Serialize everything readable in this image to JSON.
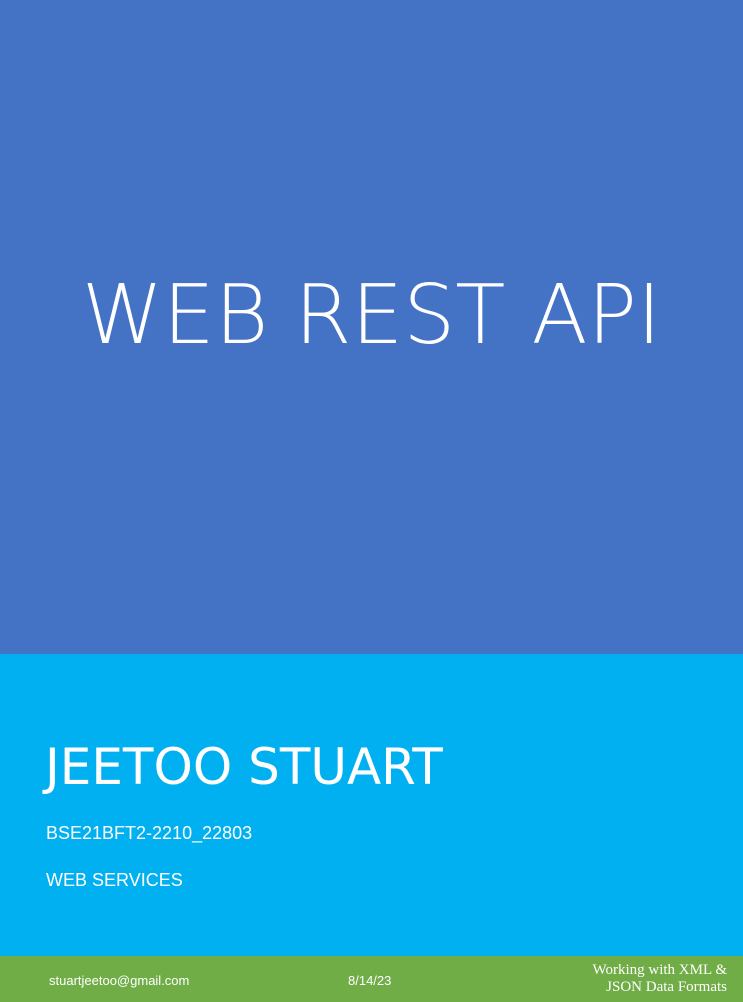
{
  "cover": {
    "title": "WEB REST API",
    "colors": {
      "title_background": "#4472c4",
      "author_background": "#00b0f0",
      "footer_background": "#70ad47",
      "text": "#ffffff"
    }
  },
  "author": {
    "name": "JEETOO STUART",
    "course_code": "BSE21BFT2-2210_22803",
    "course_name": "WEB SERVICES"
  },
  "footer": {
    "email": "stuartjeetoo@gmail.com",
    "date": "8/14/23",
    "subject_line1": "Working with XML &",
    "subject_line2": "JSON Data Formats"
  }
}
